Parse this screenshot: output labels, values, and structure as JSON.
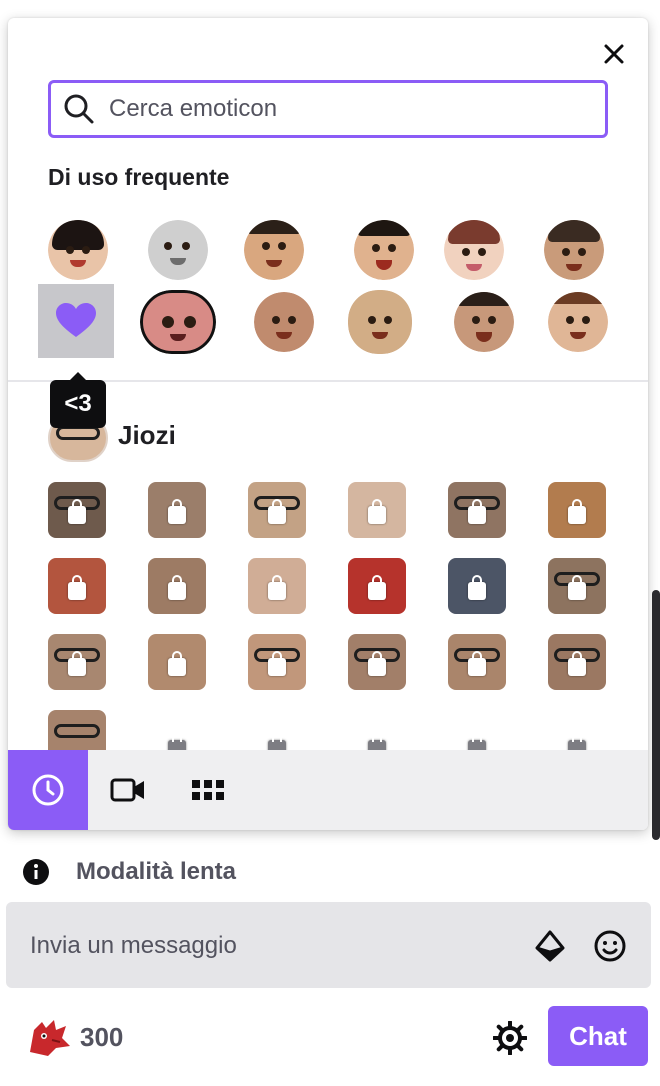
{
  "picker": {
    "search": {
      "placeholder": "Cerca emoticon"
    },
    "frequent_title": "Di uso frequente",
    "tooltip": "<3",
    "channel": {
      "name": "Jiozi"
    },
    "tabs": [
      {
        "name": "frequent",
        "icon": "clock-icon",
        "active": true
      },
      {
        "name": "video",
        "icon": "video-icon",
        "active": false
      },
      {
        "name": "all",
        "icon": "grid-icon",
        "active": false
      }
    ]
  },
  "chat": {
    "slow_mode": "Modalità lenta",
    "input_placeholder": "Invia un messaggio",
    "points": "300",
    "send_label": "Chat"
  },
  "colors": {
    "accent": "#8b5cf6",
    "panel_bg": "#ffffff",
    "input_bg": "#e5e5e8"
  }
}
